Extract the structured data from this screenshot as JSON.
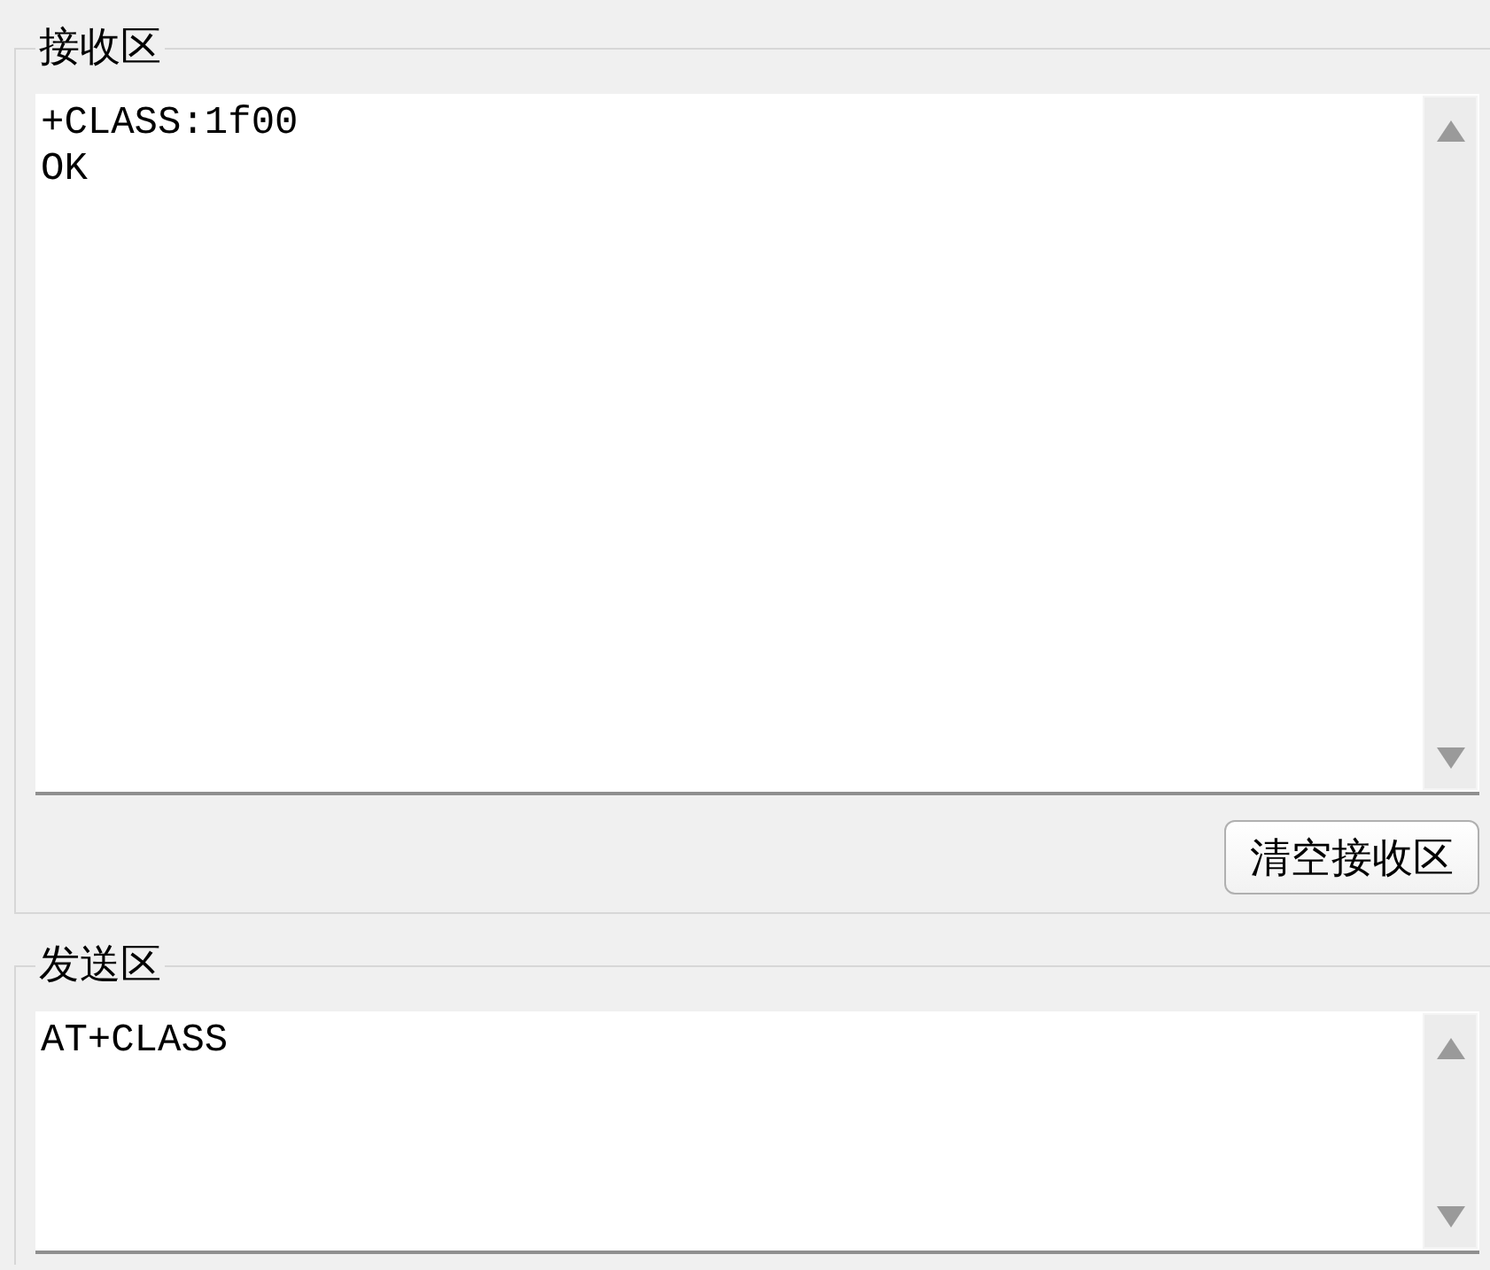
{
  "receive_area": {
    "title": "接收区",
    "lines": [
      "+CLASS:1f00",
      "OK"
    ],
    "clear_button": "清空接收区"
  },
  "send_area": {
    "title": "发送区",
    "value": "AT+CLASS"
  }
}
